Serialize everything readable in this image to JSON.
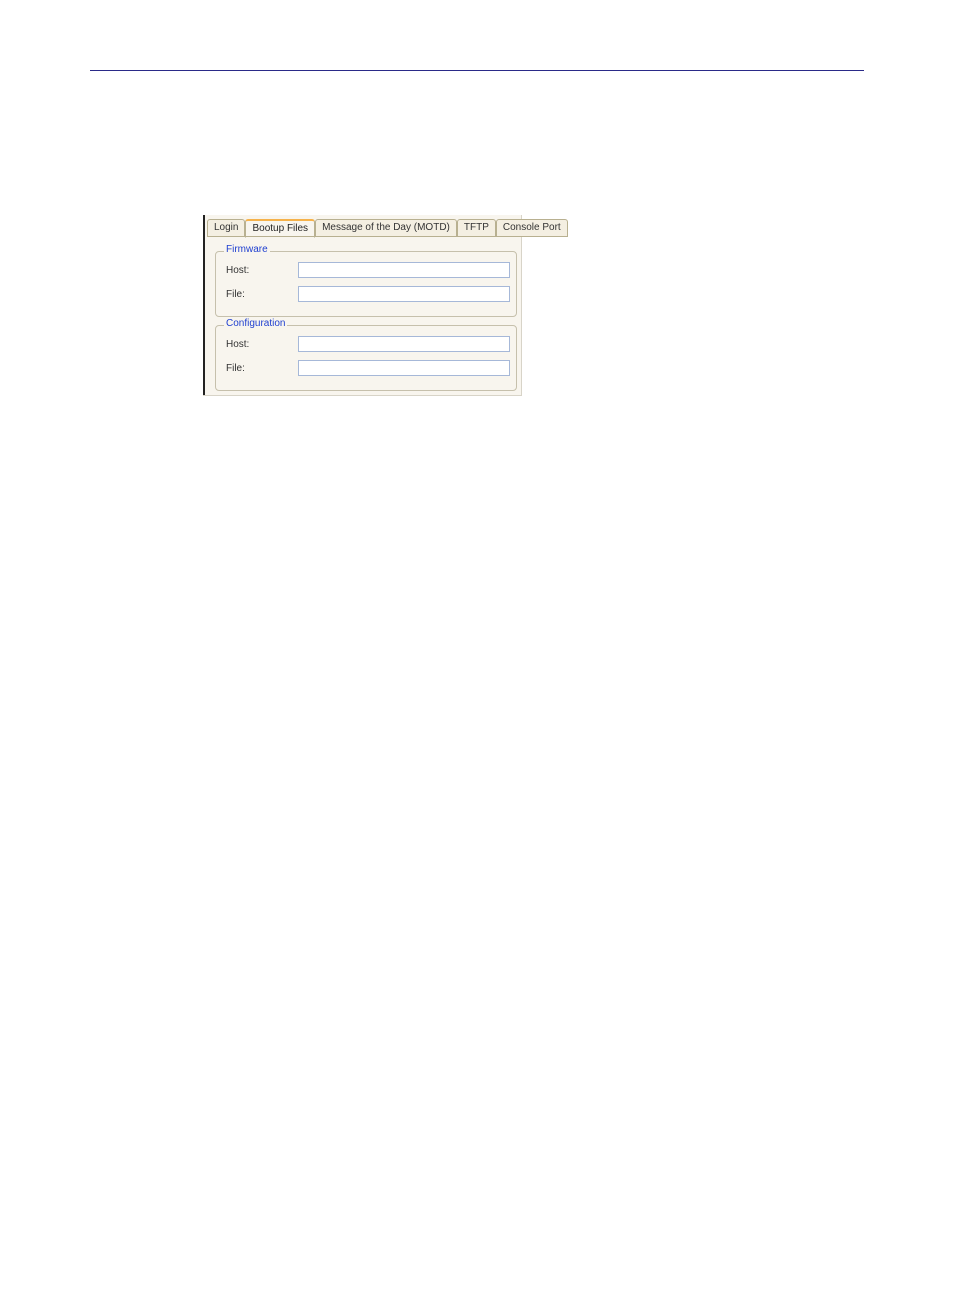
{
  "tabs": {
    "login": "Login",
    "bootup": "Bootup Files",
    "motd": "Message of the Day (MOTD)",
    "tftp": "TFTP",
    "console": "Console Port"
  },
  "firmware": {
    "legend": "Firmware",
    "host_label": "Host:",
    "file_label": "File:",
    "host_value": "",
    "file_value": ""
  },
  "configuration": {
    "legend": "Configuration",
    "host_label": "Host:",
    "file_label": "File:",
    "host_value": "",
    "file_value": ""
  }
}
